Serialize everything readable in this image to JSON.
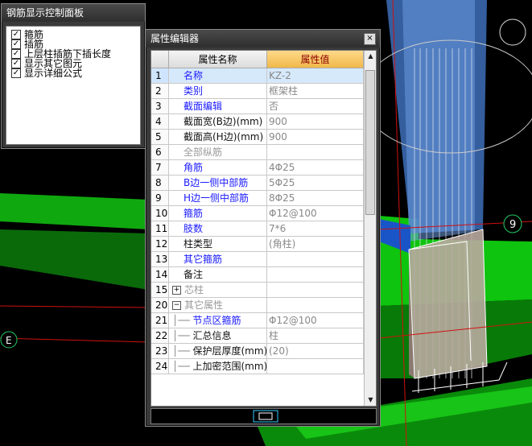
{
  "rebar_panel": {
    "title": "钢筋显示控制面板",
    "options": [
      {
        "label": "箍筋",
        "checked": true
      },
      {
        "label": "插筋",
        "checked": true
      },
      {
        "label": "上层柱插筋下插长度",
        "checked": true
      },
      {
        "label": "显示其它图元",
        "checked": true
      },
      {
        "label": "显示详细公式",
        "checked": true
      }
    ]
  },
  "property_editor": {
    "title": "属性编辑器",
    "close_label": "×",
    "columns": {
      "name": "属性名称",
      "value": "属性值"
    },
    "rows": [
      {
        "num": "1",
        "name": "名称",
        "value": "KZ-2",
        "style": "blue",
        "selected": true
      },
      {
        "num": "2",
        "name": "类别",
        "value": "框架柱",
        "style": "blue"
      },
      {
        "num": "3",
        "name": "截面编辑",
        "value": "否",
        "style": "blue"
      },
      {
        "num": "4",
        "name": "截面宽(B边)(mm)",
        "value": "900",
        "style": "black"
      },
      {
        "num": "5",
        "name": "截面高(H边)(mm)",
        "value": "900",
        "style": "black"
      },
      {
        "num": "6",
        "name": "全部纵筋",
        "value": "",
        "style": "gray"
      },
      {
        "num": "7",
        "name": "角筋",
        "value": "4Φ25",
        "style": "blue"
      },
      {
        "num": "8",
        "name": "B边一侧中部筋",
        "value": "5Φ25",
        "style": "blue"
      },
      {
        "num": "9",
        "name": "H边一侧中部筋",
        "value": "8Φ25",
        "style": "blue"
      },
      {
        "num": "10",
        "name": "箍筋",
        "value": "Φ12@100",
        "style": "blue"
      },
      {
        "num": "11",
        "name": "肢数",
        "value": "7*6",
        "style": "blue"
      },
      {
        "num": "12",
        "name": "柱类型",
        "value": "(角柱)",
        "style": "black"
      },
      {
        "num": "13",
        "name": "其它箍筋",
        "value": "",
        "style": "blue"
      },
      {
        "num": "14",
        "name": "备注",
        "value": "",
        "style": "black"
      },
      {
        "num": "15",
        "name": "芯柱",
        "value": "",
        "style": "gray",
        "expander": "+"
      },
      {
        "num": "20",
        "name": "其它属性",
        "value": "",
        "style": "gray",
        "expander": "−"
      },
      {
        "num": "21",
        "name": "节点区箍筋",
        "value": "Φ12@100",
        "style": "blue",
        "tree": true
      },
      {
        "num": "22",
        "name": "汇总信息",
        "value": "柱",
        "style": "black",
        "tree": true
      },
      {
        "num": "23",
        "name": "保护层厚度(mm)",
        "value": "(20)",
        "style": "black",
        "tree": true
      },
      {
        "num": "24",
        "name": "上加密范围(mm)",
        "value": "",
        "style": "black",
        "tree": true
      }
    ]
  },
  "scene": {
    "axis_labels": {
      "axis_9": "9",
      "axis_e": "E"
    },
    "colors": {
      "slab_green": "#0ec40e",
      "column_blue": "#5a8fd6",
      "column_body": "#b9a89e",
      "axis_red": "#d01010"
    }
  }
}
